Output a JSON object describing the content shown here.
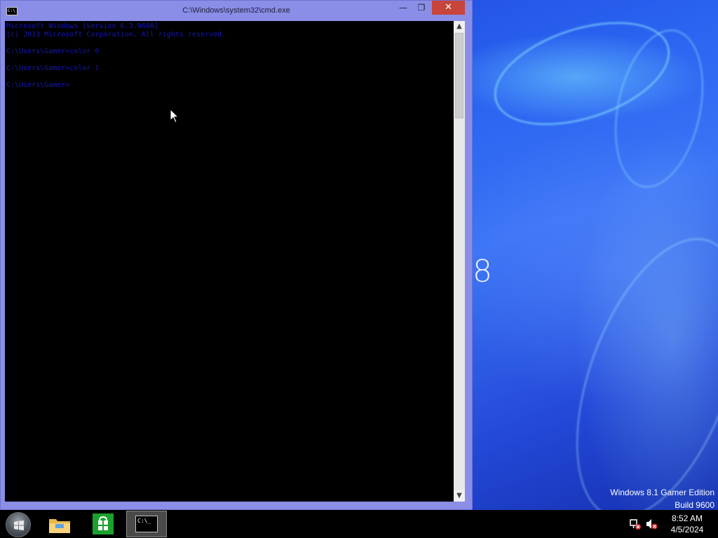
{
  "desktop": {
    "edition_line": "Windows 8.1 Gamer Edition",
    "build_line": "Build 9600",
    "logo_fragment": "8"
  },
  "cmd_window": {
    "title": "C:\\Windows\\system32\\cmd.exe",
    "minimize_glyph": "—",
    "maximize_glyph": "❐",
    "close_glyph": "✕",
    "console_lines": [
      "Microsoft Windows [Version 6.3.9600]",
      "(c) 2013 Microsoft Corporation. All rights reserved.",
      "",
      "C:\\Users\\Gamer>color 0",
      "",
      "C:\\Users\\Gamer>color 1",
      "",
      "C:\\Users\\Gamer>"
    ],
    "text_color": "#1616b8",
    "background_color": "#000000",
    "scroll_up_glyph": "▲",
    "scroll_down_glyph": "▼"
  },
  "taskbar": {
    "start_icon": "windows-orb-icon",
    "pinned": [
      {
        "name": "File Explorer",
        "icon": "folder-icon"
      },
      {
        "name": "Store",
        "icon": "store-icon"
      },
      {
        "name": "Command Prompt",
        "icon": "cmd-icon",
        "active": true
      }
    ],
    "cmd_icon_text": "C:\\_",
    "tray": {
      "network_icon": "network-disconnected-icon",
      "volume_icon": "volume-muted-icon"
    },
    "clock": {
      "time": "8:52 AM",
      "date": "4/5/2024"
    }
  },
  "colors": {
    "window_frame": "#8a8ee6",
    "close_button": "#c7453a",
    "taskbar": "#000000",
    "store_tile": "#1ba12e"
  }
}
